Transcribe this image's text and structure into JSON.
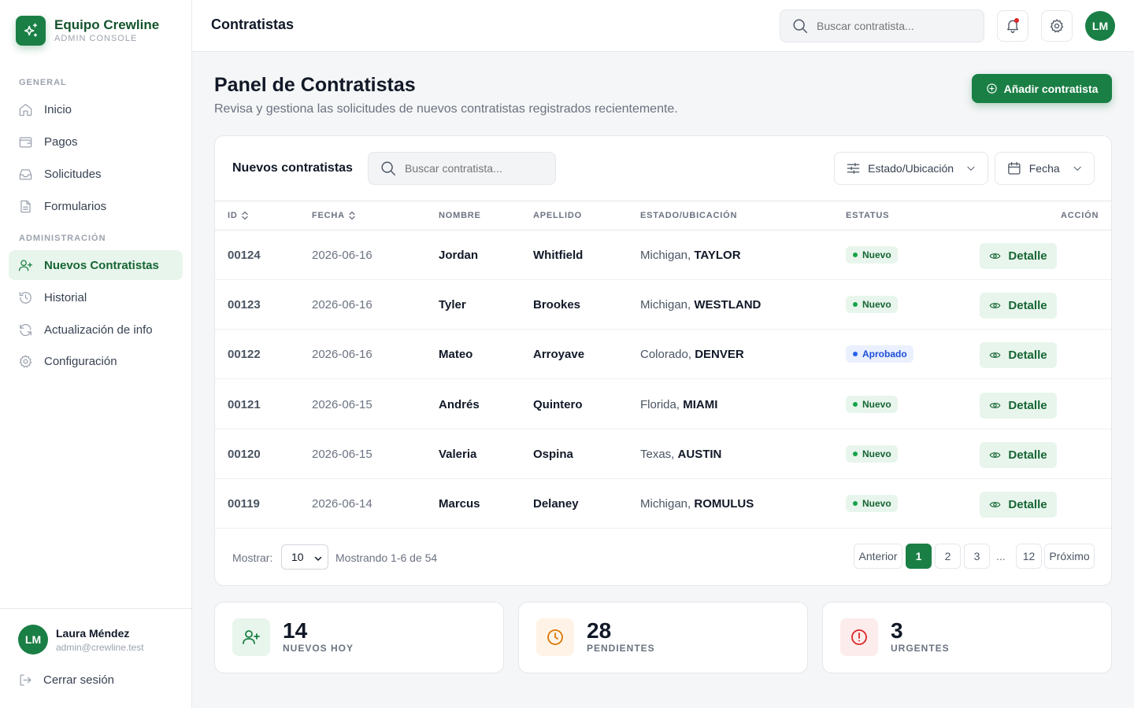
{
  "brand": {
    "name": "Equipo Crewline",
    "subtitle": "ADMIN CONSOLE"
  },
  "sidebar": {
    "section_general": "GENERAL",
    "section_admin": "ADMINISTRACIÓN",
    "items": [
      {
        "label": "Inicio",
        "icon": "home-icon"
      },
      {
        "label": "Pagos",
        "icon": "wallet-icon"
      },
      {
        "label": "Solicitudes",
        "icon": "inbox-icon"
      },
      {
        "label": "Formularios",
        "icon": "document-icon"
      },
      {
        "label": "Nuevos Contratistas",
        "icon": "user-plus-icon",
        "active": true
      },
      {
        "label": "Historial",
        "icon": "history-icon"
      },
      {
        "label": "Actualización de info",
        "icon": "refresh-icon"
      },
      {
        "label": "Configuración",
        "icon": "gear-icon"
      }
    ],
    "user": {
      "initials": "LM",
      "name": "Laura Méndez",
      "email": "admin@crewline.test"
    },
    "logout_label": "Cerrar sesión"
  },
  "topbar": {
    "title": "Contratistas",
    "search_placeholder": "Buscar contratista...",
    "avatar_initials": "LM"
  },
  "header": {
    "title": "Panel de Contratistas",
    "subtitle": "Revisa y gestiona las solicitudes de nuevos contratistas registrados recientemente.",
    "add_button": "Añadir contratista"
  },
  "table": {
    "title": "Nuevos contratistas",
    "search_placeholder": "Buscar contratista...",
    "filter_location": "Estado/Ubicación",
    "filter_date": "Fecha",
    "columns": [
      "ID",
      "FECHA",
      "NOMBRE",
      "APELLIDO",
      "ESTADO/UBICACIÓN",
      "ESTATUS",
      "ACCIÓN"
    ],
    "rows": [
      {
        "id": "00124",
        "date": "2026-06-16",
        "first": "Jordan",
        "last": "Whitfield",
        "state": "Michigan,",
        "city": "TAYLOR",
        "status": "Nuevo",
        "action": "Detalle"
      },
      {
        "id": "00123",
        "date": "2026-06-16",
        "first": "Tyler",
        "last": "Brookes",
        "state": "Michigan,",
        "city": "WESTLAND",
        "status": "Nuevo",
        "action": "Detalle"
      },
      {
        "id": "00122",
        "date": "2026-06-16",
        "first": "Mateo",
        "last": "Arroyave",
        "state": "Colorado,",
        "city": "DENVER",
        "status": "Aprobado",
        "action": "Detalle"
      },
      {
        "id": "00121",
        "date": "2026-06-15",
        "first": "Andrés",
        "last": "Quintero",
        "state": "Florida,",
        "city": "MIAMI",
        "status": "Nuevo",
        "action": "Detalle"
      },
      {
        "id": "00120",
        "date": "2026-06-15",
        "first": "Valeria",
        "last": "Ospina",
        "state": "Texas,",
        "city": "AUSTIN",
        "status": "Nuevo",
        "action": "Detalle"
      },
      {
        "id": "00119",
        "date": "2026-06-14",
        "first": "Marcus",
        "last": "Delaney",
        "state": "Michigan,",
        "city": "ROMULUS",
        "status": "Nuevo",
        "action": "Detalle"
      }
    ],
    "footer": {
      "show_label": "Mostrar:",
      "page_size": "10",
      "range": "Mostrando 1-6 de 54",
      "prev": "Anterior",
      "pages": [
        "1",
        "2",
        "3"
      ],
      "ellipsis": "...",
      "last_page": "12",
      "next": "Próximo"
    }
  },
  "stats": [
    {
      "value": "14",
      "label": "NUEVOS HOY",
      "icon": "user-plus-icon",
      "color": "#1a7f45",
      "bg": "#e8f5ec"
    },
    {
      "value": "28",
      "label": "PENDIENTES",
      "icon": "clock-icon",
      "color": "#d97706",
      "bg": "#fef3e6"
    },
    {
      "value": "3",
      "label": "URGENTES",
      "icon": "alert-circle-icon",
      "color": "#dc2626",
      "bg": "#fdecec"
    }
  ],
  "colors": {
    "accent": "#1a7f45",
    "accent_light": "#e8f5ec",
    "approved": "#1d4ed8"
  }
}
